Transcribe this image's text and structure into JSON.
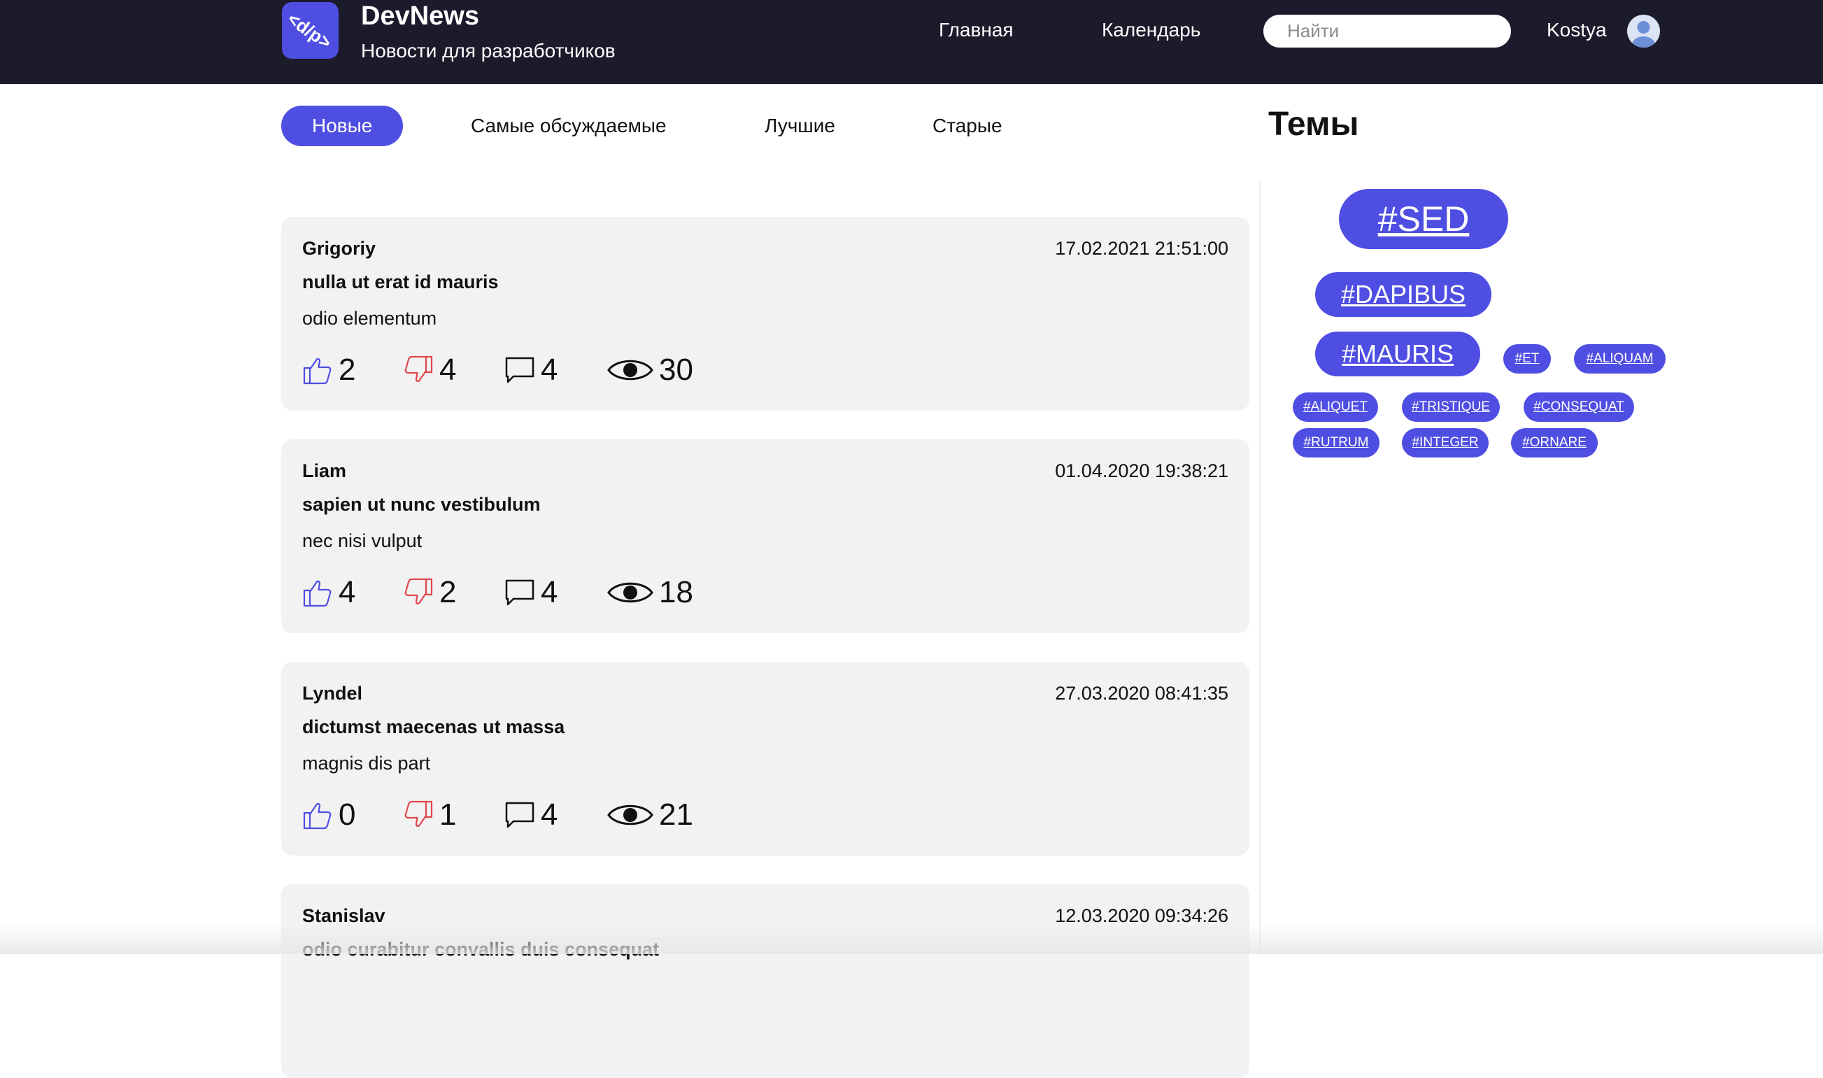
{
  "header": {
    "brand_title": "DevNews",
    "brand_subtitle": "Новости для разработчиков",
    "logo_text": "<d/p>",
    "nav": {
      "home": "Главная",
      "calendar": "Календарь"
    },
    "search_placeholder": "Найти",
    "user_name": "Kostya"
  },
  "tabs": [
    "Новые",
    "Самые обсуждаемые",
    "Лучшие",
    "Старые"
  ],
  "active_tab": "Новые",
  "topics_title": "Темы",
  "posts": [
    {
      "author": "Grigoriy",
      "date": "17.02.2021 21:51:00",
      "title": "nulla ut erat id mauris",
      "body": "odio elementum",
      "likes": "2",
      "dislikes": "4",
      "comments": "4",
      "views": "30"
    },
    {
      "author": "Liam",
      "date": "01.04.2020 19:38:21",
      "title": "sapien ut nunc vestibulum",
      "body": "nec nisi vulput",
      "likes": "4",
      "dislikes": "2",
      "comments": "4",
      "views": "18"
    },
    {
      "author": "Lyndel",
      "date": "27.03.2020 08:41:35",
      "title": "dictumst maecenas ut massa",
      "body": "magnis dis part",
      "likes": "0",
      "dislikes": "1",
      "comments": "4",
      "views": "21"
    },
    {
      "author": "Stanislav",
      "date": "12.03.2020 09:34:26",
      "title": "odio curabitur convallis duis consequat",
      "body": "",
      "likes": "",
      "dislikes": "",
      "comments": "",
      "views": ""
    }
  ],
  "tags": [
    "#SED",
    "#DAPIBUS",
    "#MAURIS",
    "#ET",
    "#ALIQUAM",
    "#ALIQUET",
    "#TRISTIQUE",
    "#CONSEQUAT",
    "#RUTRUM",
    "#INTEGER",
    "#ORNARE"
  ],
  "colors": {
    "header_bg": "#1c1b2c",
    "accent": "#4f4ee2",
    "card_bg": "#f2f2f2",
    "like": "#4f4ee2",
    "dislike": "#e0474c"
  },
  "icons": [
    "logo-icon",
    "avatar-icon",
    "thumbs-up-icon",
    "thumbs-down-icon",
    "comment-icon",
    "eye-icon"
  ]
}
